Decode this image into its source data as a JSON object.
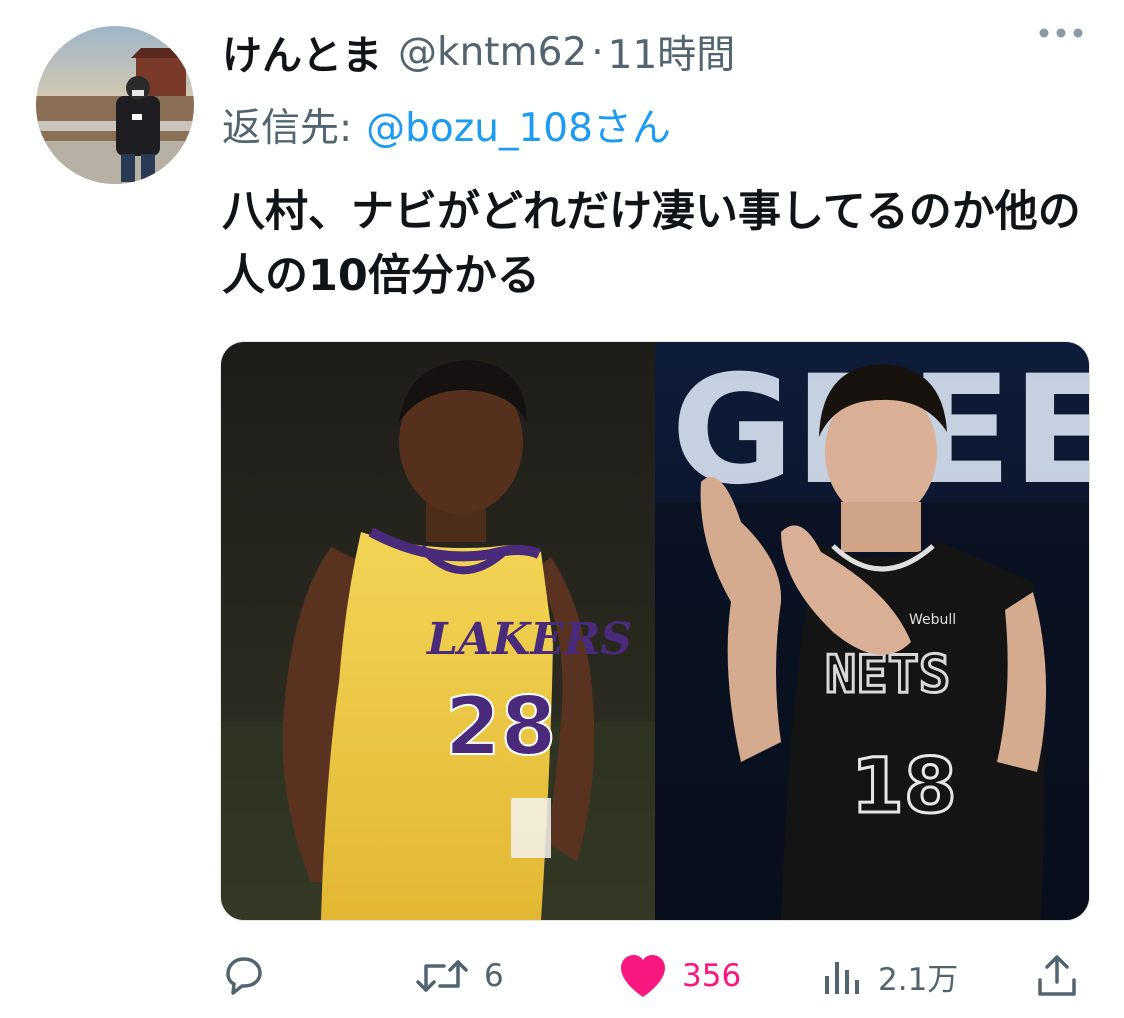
{
  "tweet": {
    "display_name": "けんとま",
    "handle": "@kntm62",
    "separator": "·",
    "timestamp": "11時間",
    "reply_label": "返信先:",
    "reply_to": "@bozu_108さん",
    "text": "八村、ナビがどれだけ凄い事してるのか他の人の10倍分かる"
  },
  "media": {
    "left_jersey": {
      "team": "LAKERS",
      "number": "28"
    },
    "right_jersey": {
      "team": "NETS",
      "number": "18",
      "sponsor": "Webull"
    },
    "background_letters": "GREE"
  },
  "actions": {
    "replies": "",
    "retweets": "6",
    "likes": "356",
    "views": "2.1万"
  },
  "colors": {
    "text": "#0f1419",
    "secondary": "#536471",
    "link": "#1d9bf0",
    "like": "#f91880"
  },
  "icons": {
    "reply": "reply-icon",
    "retweet": "retweet-icon",
    "like": "heart-icon",
    "views": "views-icon",
    "share": "share-icon",
    "more": "more-icon"
  }
}
